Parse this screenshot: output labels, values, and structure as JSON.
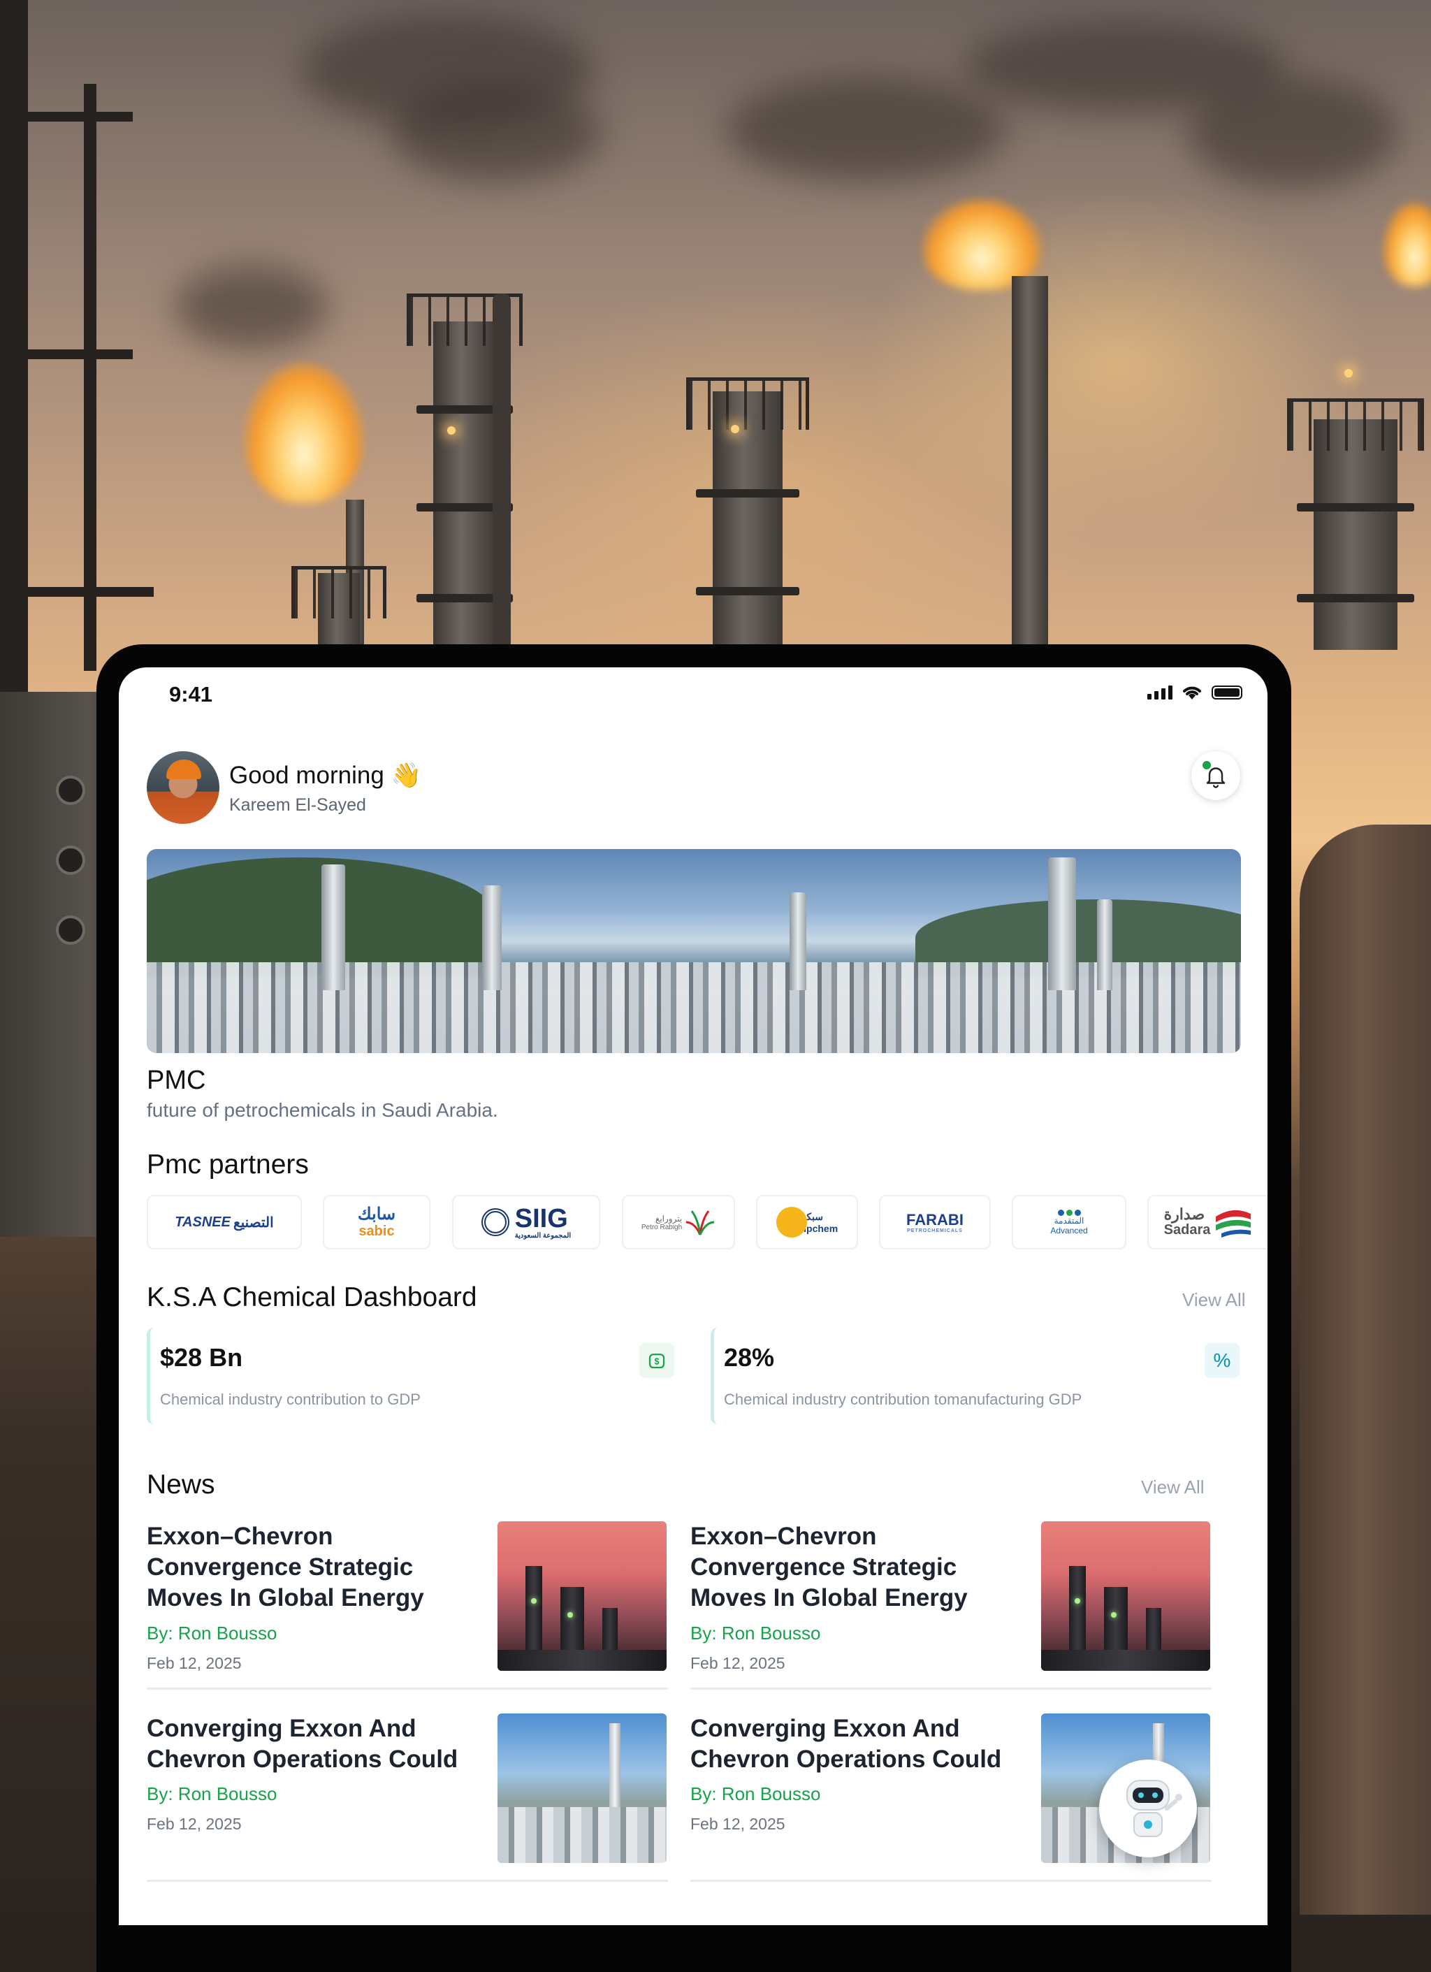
{
  "status_bar": {
    "time": "9:41"
  },
  "header": {
    "greeting": "Good morning 👋",
    "user_name": "Kareem El-Sayed",
    "notification_icon": "bell-icon",
    "notification_dot_color": "#16a34a"
  },
  "hero": {
    "title": "PMC",
    "subtitle": "future of petrochemicals in Saudi Arabia."
  },
  "partners": {
    "title": "Pmc partners",
    "items": [
      {
        "name": "TASNEE",
        "arabic": "التصنيع"
      },
      {
        "name": "sabic",
        "arabic": "سابك"
      },
      {
        "name": "SIIG",
        "arabic": "المجموعة السعودية"
      },
      {
        "name": "Petro Rabigh",
        "arabic": "بترورابغ"
      },
      {
        "name": "Sipchem",
        "arabic": "سبكيم"
      },
      {
        "name": "FARABI",
        "arabic": "PETROCHEMICALS"
      },
      {
        "name": "Advanced",
        "arabic": "المتقدمة"
      },
      {
        "name": "Sadara",
        "arabic": "صدارة"
      }
    ]
  },
  "dashboard": {
    "title": "K.S.A Chemical Dashboard",
    "view_all": "View All",
    "stats": [
      {
        "value": "$28 Bn",
        "label": "Chemical industry contribution to GDP",
        "icon": "money-icon",
        "icon_color": "#16a34a"
      },
      {
        "value": "28%",
        "label": "Chemical industry contribution tomanufacturing GDP",
        "icon": "%",
        "icon_color": "#0891b2"
      }
    ]
  },
  "news": {
    "title": "News",
    "view_all": "View All",
    "items": [
      {
        "title": "Exxon–Chevron Convergence Strategic Moves In Global Energy",
        "author": "By: Ron Bousso",
        "date": "Feb 12, 2025"
      },
      {
        "title": "Exxon–Chevron Convergence Strategic Moves In Global Energy",
        "author": "By: Ron Bousso",
        "date": "Feb 12, 2025"
      },
      {
        "title": "Converging Exxon And Chevron Operations Could",
        "author": "By: Ron Bousso",
        "date": "Feb 12, 2025"
      },
      {
        "title": "Converging Exxon And Chevron Operations Could",
        "author": "By: Ron Bousso",
        "date": "Feb 12, 2025"
      }
    ]
  },
  "assistant": {
    "icon": "robot-icon"
  }
}
